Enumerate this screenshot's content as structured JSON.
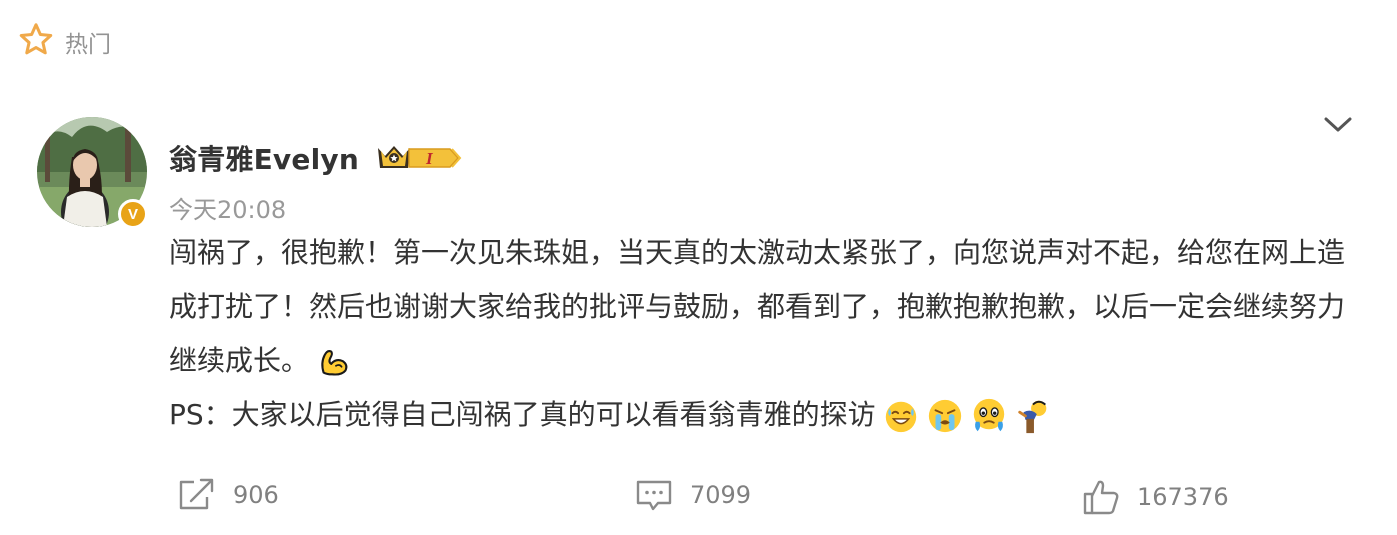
{
  "section": {
    "label": "热门",
    "icon": "star-outline-icon",
    "accent": "#f0a94a"
  },
  "post": {
    "author": {
      "name": "翁青雅Evelyn",
      "verified_badge": "V",
      "level_badge": "I"
    },
    "timestamp": "今天20:08",
    "content": {
      "line1": "闯祸了，很抱歉！第一次见朱珠姐，当天真的太激动太紧张了，向您说声对不起，给您在网上造成打扰了！然后也谢谢大家给我的批评与鼓励，都看到了，抱歉抱歉抱歉，以后一定会继续努力继续成长。",
      "line2": "PS：大家以后觉得自己闯祸了真的可以看看翁青雅的探访"
    },
    "emojis": [
      "muscle-emoji",
      "grin-sweat-emoji",
      "crying-emoji",
      "teary-emoji",
      "bowing-emoji"
    ],
    "actions": {
      "repost_count": "906",
      "comment_count": "7099",
      "like_count": "167376"
    }
  }
}
